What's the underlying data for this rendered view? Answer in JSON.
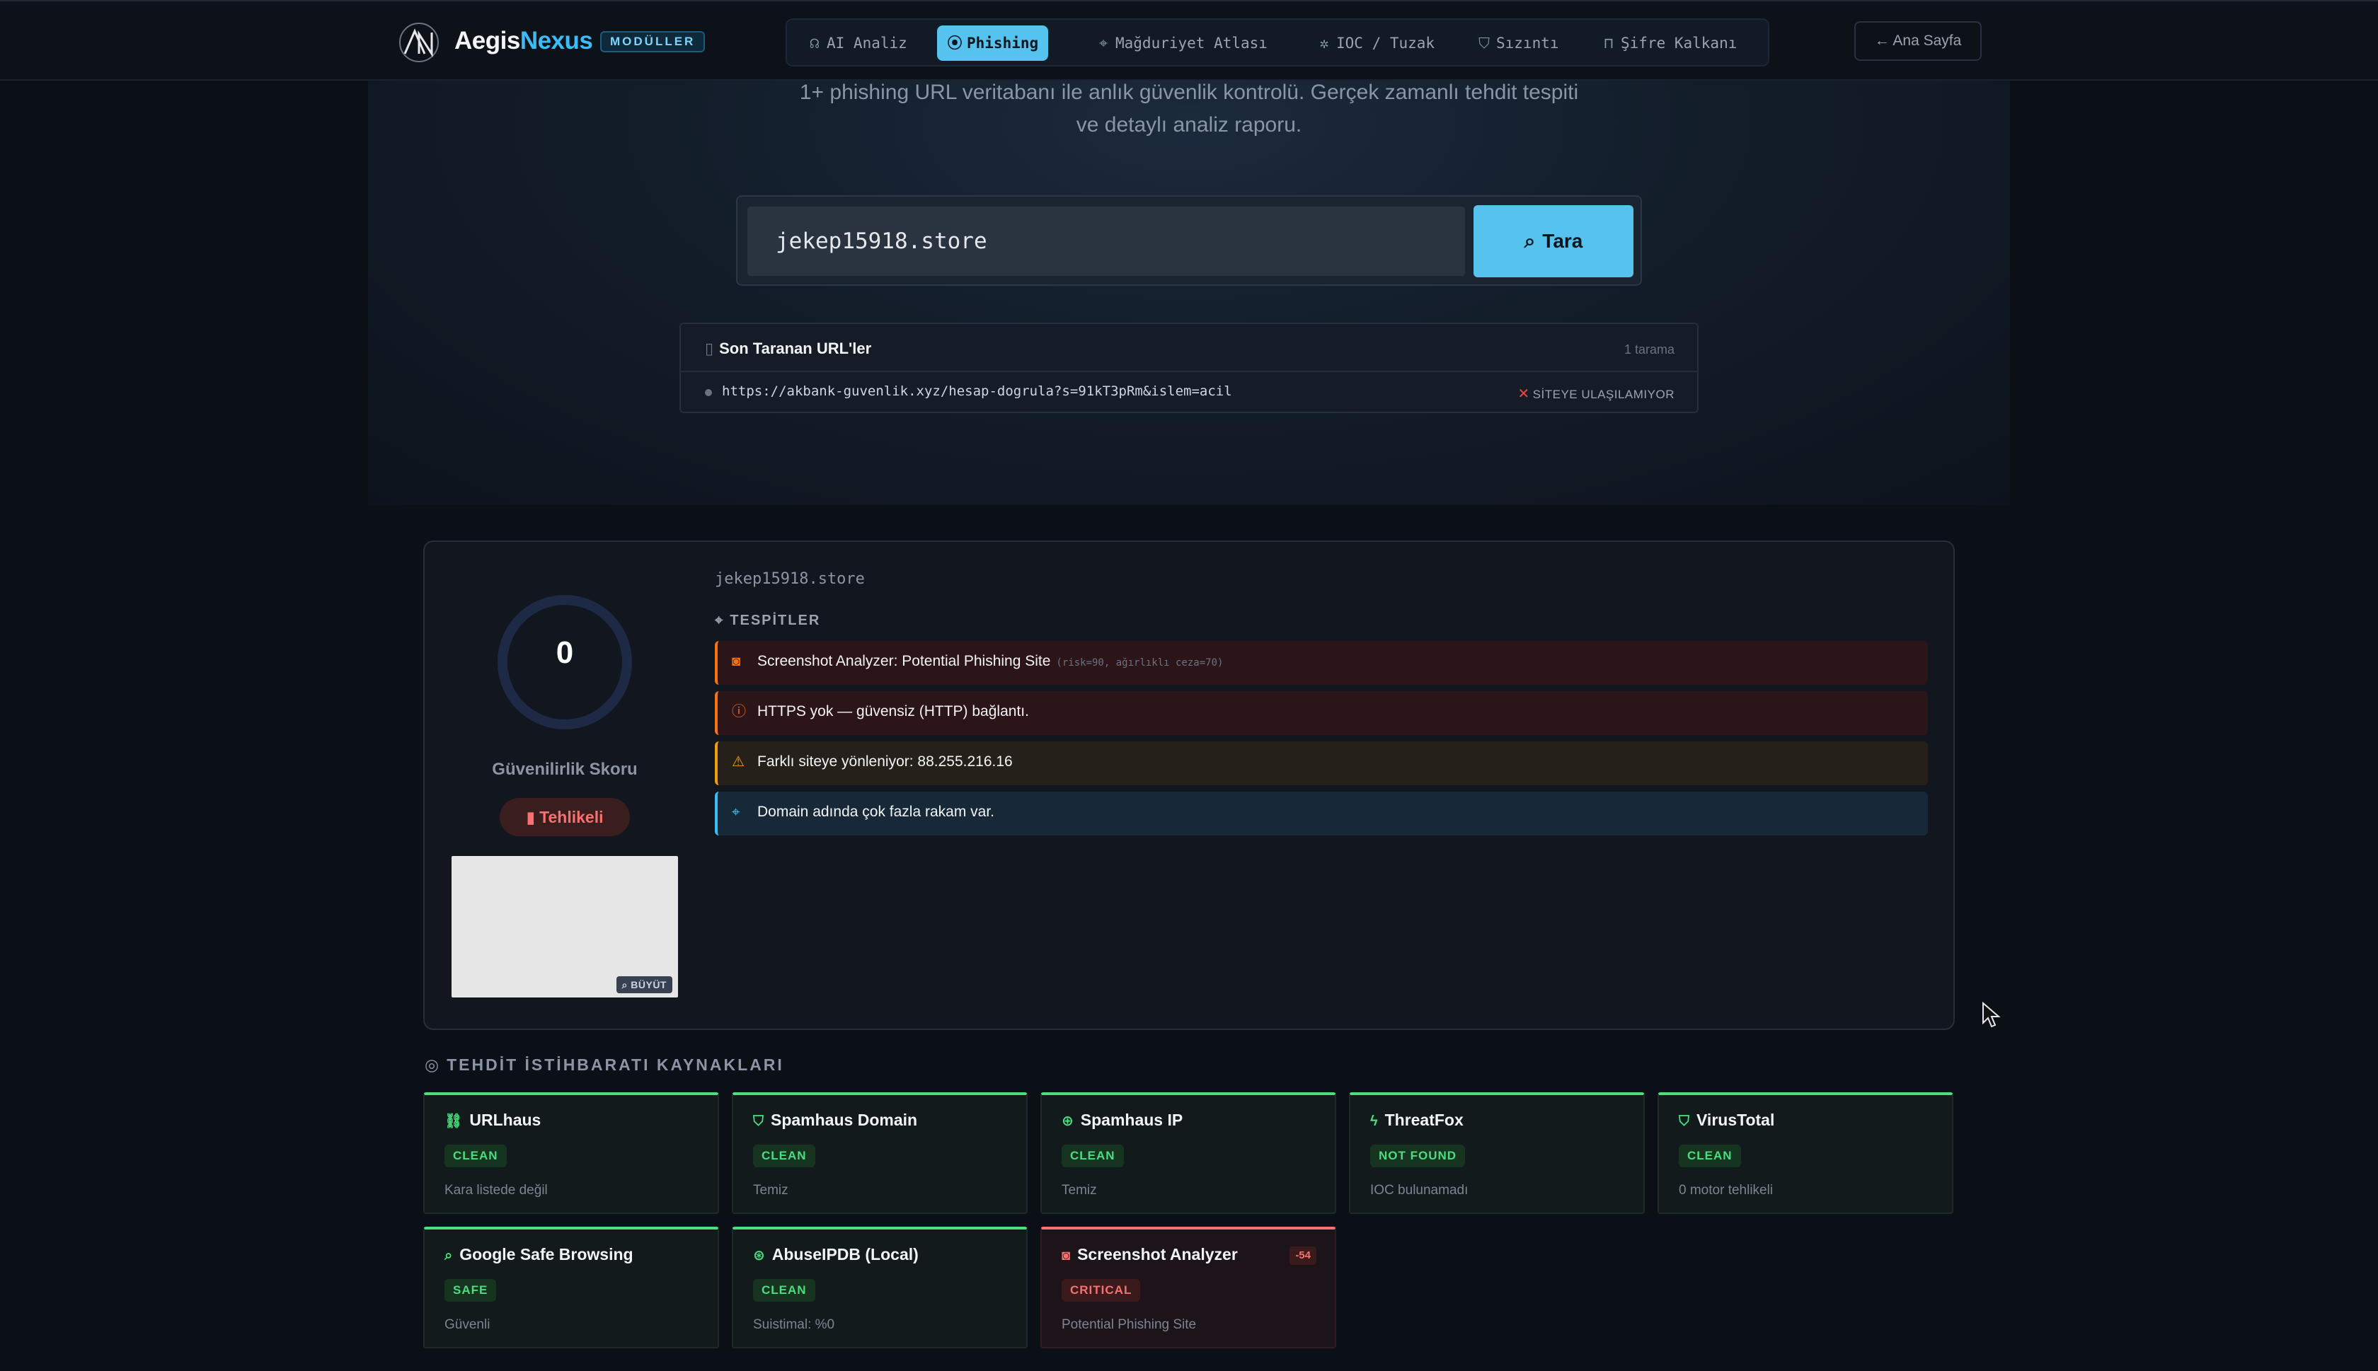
{
  "brand": {
    "part1": "Aegis",
    "part2": "Nexus",
    "badge": "MODÜLLER"
  },
  "nav": {
    "tabs": [
      {
        "label": "AI Analiz",
        "icon": "brain-icon",
        "glyph": "☊"
      },
      {
        "label": "Phishing",
        "icon": "radio-icon",
        "glyph": "((·))",
        "active": true
      },
      {
        "label": "Mağduriyet Atlası",
        "icon": "pin-icon",
        "glyph": "⌖"
      },
      {
        "label": "IOC / Tuzak",
        "icon": "bug-icon",
        "glyph": "✲"
      },
      {
        "label": "Sızıntı",
        "icon": "shield-icon",
        "glyph": "⛉"
      },
      {
        "label": "Şifre Kalkanı",
        "icon": "lock-icon",
        "glyph": "🔒"
      }
    ],
    "home": "← Ana Sayfa"
  },
  "hero": {
    "subtitle_line1": "1+ phishing URL veritabanı ile anlık güvenlik kontrolü. Gerçek zamanlı tehdit tespiti",
    "subtitle_line2": "ve detaylı analiz raporu.",
    "search_value": "jekep15918.store",
    "scan_label": "Tara"
  },
  "recent": {
    "title": "Son Taranan URL'ler",
    "count": "1 tarama",
    "items": [
      {
        "url": "https://akbank-guvenlik.xyz/hesap-dogrula?s=91kT3pRm&islem=acil",
        "status": "SİTEYE ULAŞILAMIYOR"
      }
    ]
  },
  "result": {
    "score": "0",
    "score_label": "Güvenilirlik Skoru",
    "verdict": "Tehlikeli",
    "zoom_label": "BÜYÜT",
    "domain": "jekep15918.store",
    "findings_label": "TESPİTLER",
    "findings": [
      {
        "text": "Screenshot Analyzer: Potential Phishing Site",
        "note": "(risk=90, ağırlıklı ceza=70)",
        "icon": "camera-icon",
        "severity": "high"
      },
      {
        "text": "HTTPS yok — güvensiz (HTTP) bağlantı.",
        "note": "",
        "icon": "alert-circle-icon",
        "severity": "high"
      },
      {
        "text": "Farklı siteye yönleniyor: 88.255.216.16",
        "note": "",
        "icon": "warning-icon",
        "severity": "medium"
      },
      {
        "text": "Domain adında çok fazla rakam var.",
        "note": "",
        "icon": "info-pin-icon",
        "severity": "info"
      }
    ]
  },
  "intel": {
    "title": "TEHDİT İSTİHBARATI KAYNAKLARI",
    "sources": [
      {
        "name": "URLhaus",
        "status": "CLEAN",
        "desc": "Kara listede değil",
        "icon": "link-icon",
        "glyph": "⛓"
      },
      {
        "name": "Spamhaus Domain",
        "status": "CLEAN",
        "desc": "Temiz",
        "icon": "shield-icon",
        "glyph": "⛉"
      },
      {
        "name": "Spamhaus IP",
        "status": "CLEAN",
        "desc": "Temiz",
        "icon": "globe-icon",
        "glyph": "⊕"
      },
      {
        "name": "ThreatFox",
        "status": "NOT FOUND",
        "desc": "IOC bulunamadı",
        "icon": "bolt-icon",
        "glyph": "ϟ"
      },
      {
        "name": "VirusTotal",
        "status": "CLEAN",
        "desc": "0 motor tehlikeli",
        "icon": "shield-icon",
        "glyph": "⛉"
      },
      {
        "name": "Google Safe Browsing",
        "status": "SAFE",
        "desc": "Güvenli",
        "icon": "search-icon",
        "glyph": "⌕"
      },
      {
        "name": "AbuseIPDB (Local)",
        "status": "CLEAN",
        "desc": "Suistimal: %0",
        "icon": "database-icon",
        "glyph": "⊛"
      },
      {
        "name": "Screenshot Analyzer",
        "status": "CRITICAL",
        "desc": "Potential Phishing Site",
        "icon": "camera-icon",
        "glyph": "◙",
        "penalty": "-54",
        "critical": true
      }
    ]
  },
  "colors": {
    "accent": "#56c2ee",
    "clean": "#4ade80",
    "danger": "#f87171",
    "warning": "#f59e0b",
    "info": "#38bdf8"
  }
}
